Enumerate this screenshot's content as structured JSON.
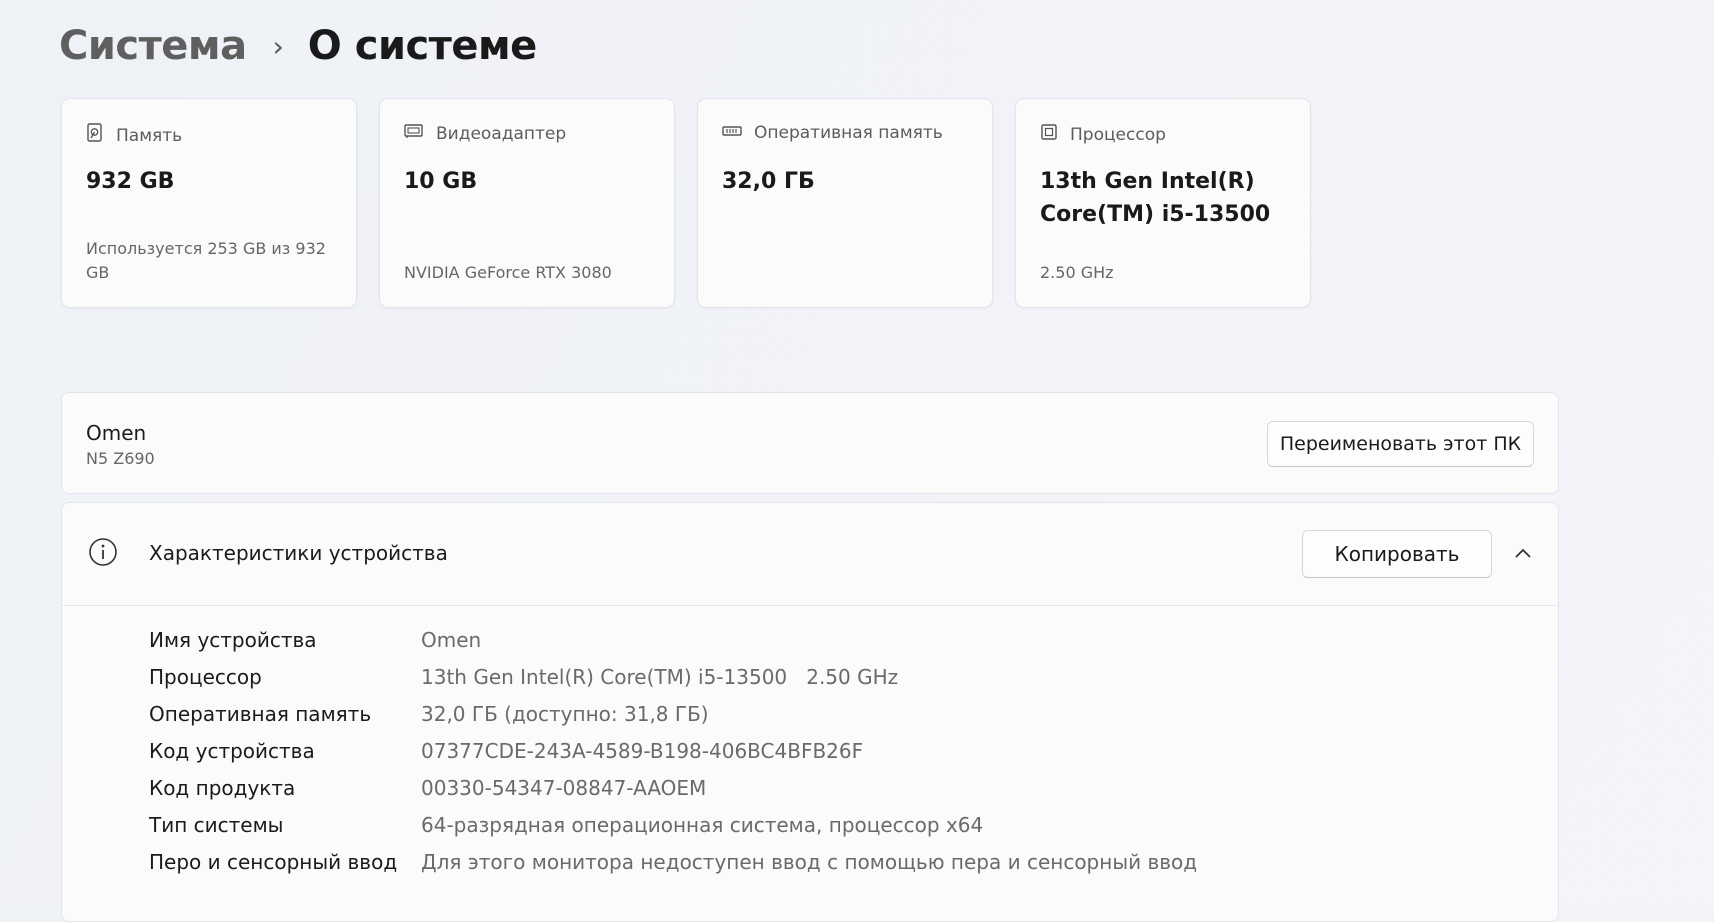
{
  "breadcrumb": {
    "parent": "Система",
    "separator": "›",
    "current": "О системе"
  },
  "cards": [
    {
      "icon": "storage-icon",
      "title": "Память",
      "value": "932 GB",
      "sub": "Используется 253 GB из 932 GB"
    },
    {
      "icon": "display-adapter-icon",
      "title": "Видеоадаптер",
      "value": "10 GB",
      "sub": "NVIDIA GeForce RTX 3080"
    },
    {
      "icon": "ram-icon",
      "title": "Оперативная память",
      "value": "32,0 ГБ",
      "sub": ""
    },
    {
      "icon": "processor-icon",
      "title": "Процессор",
      "value": "13th Gen Intel(R) Core(TM) i5-13500",
      "sub": "2.50 GHz"
    }
  ],
  "pc": {
    "name": "Omen",
    "model": "N5 Z690",
    "rename_label": "Переименовать этот ПК"
  },
  "specs": {
    "title": "Характеристики устройства",
    "copy_label": "Копировать",
    "rows": [
      {
        "label": "Имя устройства",
        "value": "Omen"
      },
      {
        "label": "Процессор",
        "value": "13th Gen Intel(R) Core(TM) i5-13500   2.50 GHz"
      },
      {
        "label": "Оперативная память",
        "value": "32,0 ГБ (доступно: 31,8 ГБ)"
      },
      {
        "label": "Код устройства",
        "value": "07377CDE-243A-4589-B198-406BC4BFB26F"
      },
      {
        "label": "Код продукта",
        "value": "00330-54347-08847-AAOEM"
      },
      {
        "label": "Тип системы",
        "value": "64-разрядная операционная система, процессор x64"
      },
      {
        "label": "Перо и сенсорный ввод",
        "value": "Для этого монитора недоступен ввод с помощью пера и сенсорный ввод"
      }
    ]
  }
}
